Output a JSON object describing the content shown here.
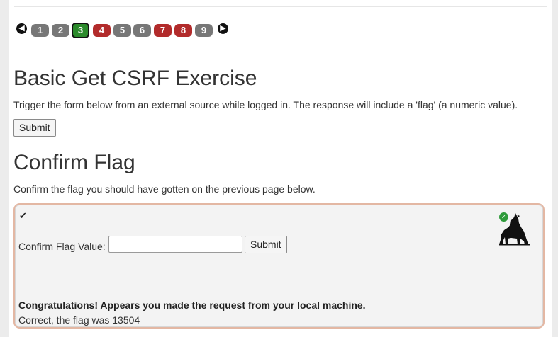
{
  "pagination": {
    "prev_icon": "arrow-left-circle-icon",
    "next_icon": "arrow-right-circle-icon",
    "pages": [
      {
        "label": "1",
        "state": "gray"
      },
      {
        "label": "2",
        "state": "gray"
      },
      {
        "label": "3",
        "state": "current"
      },
      {
        "label": "4",
        "state": "red"
      },
      {
        "label": "5",
        "state": "gray"
      },
      {
        "label": "6",
        "state": "gray"
      },
      {
        "label": "7",
        "state": "red"
      },
      {
        "label": "8",
        "state": "red"
      },
      {
        "label": "9",
        "state": "gray"
      }
    ],
    "colors": {
      "gray": "#777777",
      "red": "#b22b2b",
      "current": "#2b8a2b"
    }
  },
  "exercise": {
    "title": "Basic Get CSRF Exercise",
    "description": "Trigger the form below from an external source while logged in. The response will include a 'flag' (a numeric value).",
    "submit_label": "Submit"
  },
  "confirm": {
    "title": "Confirm Flag",
    "description": "Confirm the flag you should have gotten on the previous page below.",
    "panel": {
      "check_icon": "checkmark-icon",
      "field_label": "Confirm Flag Value:",
      "input_value": "",
      "submit_label": "Submit",
      "status_icon": "success-check-icon",
      "mascot_icon": "howling-wolf-icon",
      "success_message": "Congratulations! Appears you made the request from your local machine.",
      "result_message": "Correct, the flag was 13504"
    }
  }
}
